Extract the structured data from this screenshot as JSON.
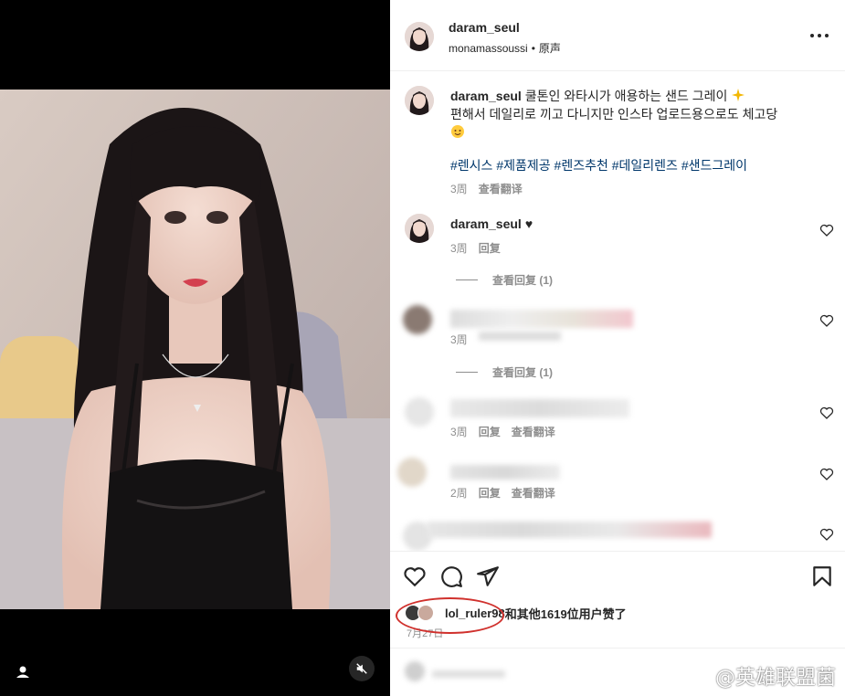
{
  "post": {
    "username": "daram_seul",
    "audio_source": "monamassoussi",
    "audio_type": "原声",
    "caption_line1": "쿨톤인 와타시가 애용하는 샌드 그레이 ",
    "caption_line2": "편해서 데일리로 끼고 다니지만 인스타 업로드용으로도 체고당",
    "hashtags": [
      "#렌시스",
      "#제품제공",
      "#렌즈추천",
      "#데일리렌즈",
      "#샌드그레이"
    ],
    "caption_time": "3周",
    "translate_label": "查看翻译"
  },
  "comments": {
    "first": {
      "username": "daram_seul",
      "time": "3周",
      "reply_label": "回复"
    },
    "view_replies_1": "查看回复 (1)",
    "view_replies_2": "查看回复 (1)",
    "blurred_1": {
      "time": "3周"
    },
    "blurred_2": {
      "time": "3周",
      "reply_label": "回复",
      "translate_label": "查看翻译"
    },
    "blurred_3": {
      "time": "2周",
      "reply_label": "回复",
      "translate_label": "查看翻译"
    }
  },
  "footer": {
    "liker": "lol_ruler98",
    "likes_rest": "和其他1619位用户赞了",
    "date": "7月27日"
  },
  "watermark": "@英雄联盟菌",
  "colors": {
    "hashtag": "#00376b",
    "meta": "#8e8e8e",
    "annotation": "#d0312d"
  },
  "icons": [
    "user-tag-icon",
    "mute-icon",
    "more-icon",
    "heart-icon",
    "comment-icon",
    "share-icon",
    "bookmark-icon",
    "weibo-logo-icon"
  ]
}
